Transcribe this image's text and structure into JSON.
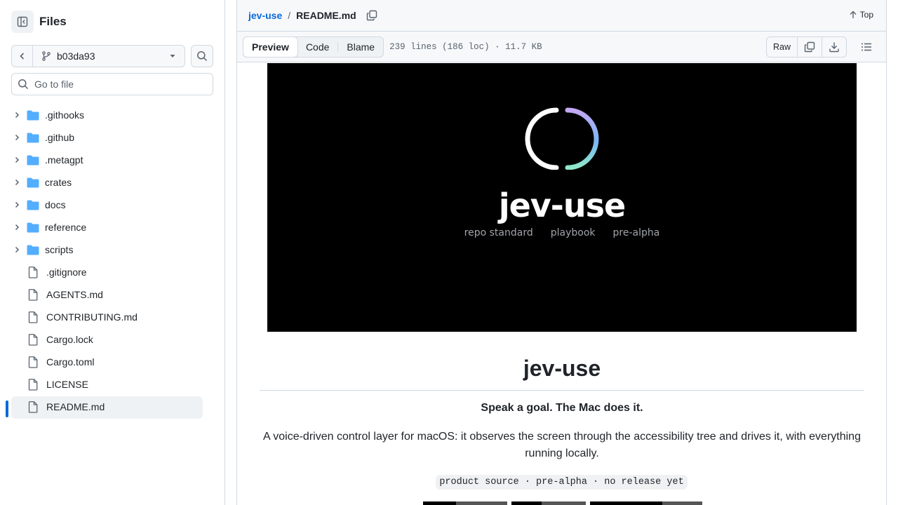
{
  "sidebar": {
    "title": "Files",
    "branch": "b03da93",
    "goto_placeholder": "Go to file",
    "items": [
      {
        "type": "folder",
        "name": ".githooks"
      },
      {
        "type": "folder",
        "name": ".github"
      },
      {
        "type": "folder",
        "name": ".metagpt"
      },
      {
        "type": "folder",
        "name": "crates"
      },
      {
        "type": "folder",
        "name": "docs"
      },
      {
        "type": "folder",
        "name": "reference"
      },
      {
        "type": "folder",
        "name": "scripts"
      },
      {
        "type": "file",
        "name": ".gitignore"
      },
      {
        "type": "file",
        "name": "AGENTS.md"
      },
      {
        "type": "file",
        "name": "CONTRIBUTING.md"
      },
      {
        "type": "file",
        "name": "Cargo.lock"
      },
      {
        "type": "file",
        "name": "Cargo.toml"
      },
      {
        "type": "file",
        "name": "LICENSE"
      },
      {
        "type": "file",
        "name": "README.md",
        "selected": true
      }
    ]
  },
  "breadcrumb": {
    "repo": "jev-use",
    "separator": "/",
    "file": "README.md"
  },
  "top_label": "Top",
  "filebar": {
    "tabs": [
      "Preview",
      "Code",
      "Blame"
    ],
    "active_tab": "Preview",
    "info": "239 lines (186 loc) · 11.7 KB",
    "raw_label": "Raw"
  },
  "readme": {
    "banner_title": "jev-use",
    "banner_subtitles": [
      "repo standard",
      "playbook",
      "pre-alpha"
    ],
    "heading": "jev-use",
    "tagline": "Speak a goal. The Mac does it.",
    "description": "A voice-driven control layer for macOS: it observes the screen through the accessibility tree and drives it, with everything running locally.",
    "code_line": "product source · pre-alpha · no release yet"
  },
  "colors": {
    "link": "#0969da",
    "folder": "#54aeff",
    "selected_bar": "#0969da"
  },
  "icons": [
    "sidebar-collapse-icon",
    "chevron-left-icon",
    "git-branch-icon",
    "triangle-down-icon",
    "search-icon",
    "chevron-right-icon",
    "folder-icon",
    "file-icon",
    "copy-icon",
    "arrow-up-icon",
    "download-icon",
    "list-unordered-icon"
  ]
}
